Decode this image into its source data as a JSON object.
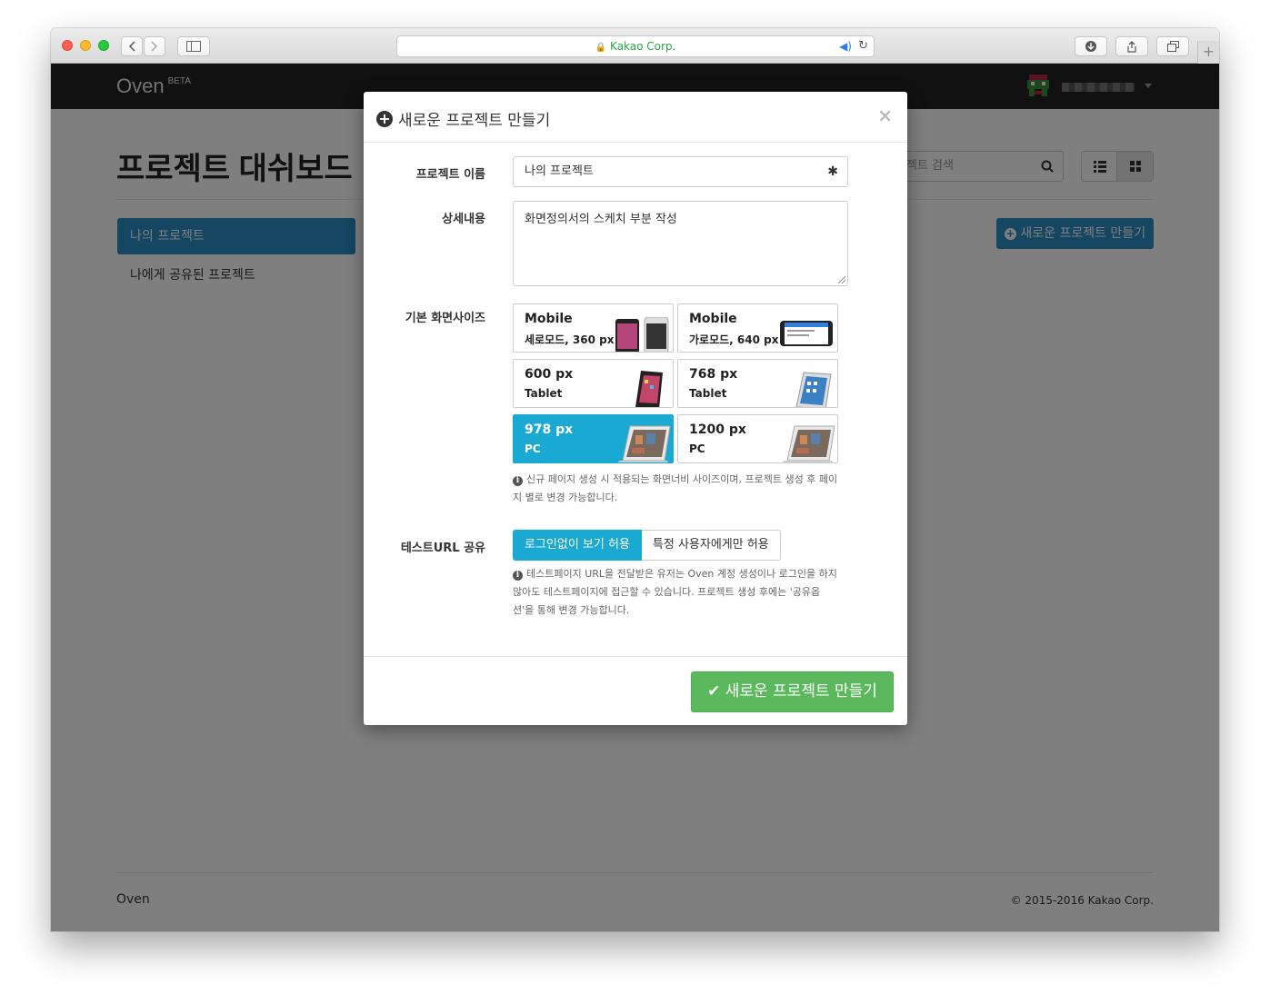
{
  "browser": {
    "address": "Kakao Corp."
  },
  "navbar": {
    "brand": "Oven",
    "brand_badge": "BETA"
  },
  "page": {
    "title": "프로젝트 대쉬보드",
    "search_placeholder": "젝트 검색",
    "sidebar": [
      {
        "label": "나의 프로젝트",
        "active": true
      },
      {
        "label": "나에게 공유된 프로젝트",
        "active": false
      }
    ],
    "new_project_button": "새로운 프로젝트 만들기",
    "footer_left": "Oven",
    "footer_right": "© 2015-2016 Kakao Corp."
  },
  "modal": {
    "title": "새로운 프로젝트 만들기",
    "fields": {
      "name_label": "프로젝트 이름",
      "name_value": "나의 프로젝트",
      "desc_label": "상세내용",
      "desc_value": "화면정의서의 스케치 부분 작성",
      "size_label": "기본 화면사이즈",
      "share_label": "테스트URL 공유"
    },
    "sizes": [
      {
        "title": "Mobile",
        "subtitle": "세로모드, 360 px",
        "device": "phone-portrait",
        "selected": false
      },
      {
        "title": "Mobile",
        "subtitle": "가로모드, 640 px",
        "device": "phone-landscape",
        "selected": false
      },
      {
        "title": "600 px",
        "subtitle": "Tablet",
        "device": "tablet-small",
        "selected": false
      },
      {
        "title": "768 px",
        "subtitle": "Tablet",
        "device": "tablet-large",
        "selected": false
      },
      {
        "title": "978 px",
        "subtitle": "PC",
        "device": "laptop",
        "selected": true
      },
      {
        "title": "1200 px",
        "subtitle": "PC",
        "device": "laptop",
        "selected": false
      }
    ],
    "size_help": [
      "신규 페이지 생성 시 적용되는 화면너비 사이즈이며, 프로젝트 생성 후 페이",
      "지 별로 변경 가능합니다."
    ],
    "share_options": [
      {
        "label": "로그인없이 보기 허용",
        "selected": true
      },
      {
        "label": "특정 사용자에게만 허용",
        "selected": false
      }
    ],
    "share_help": [
      "테스트페이지 URL을 전달받은 유저는 Oven 계정 생성이나 로그인을 하지",
      "않아도 테스트페이지에 접근할 수 있습니다. 프로젝트 생성 후에는 '공유옵",
      "션'을 통해 변경 가능합니다."
    ],
    "submit_label": "새로운 프로젝트 만들기",
    "close_label": "×"
  },
  "colors": {
    "accent": "#1aa9d3",
    "primary": "#2a8dc4",
    "success": "#5cb85c",
    "navbar": "#222222"
  }
}
